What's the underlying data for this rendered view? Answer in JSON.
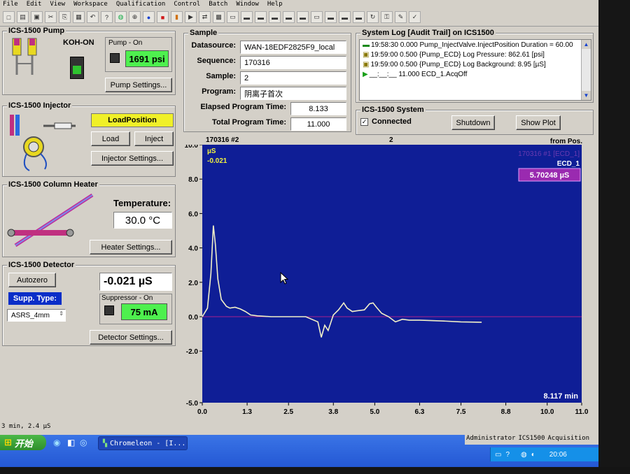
{
  "menu": [
    "File",
    "Edit",
    "View",
    "Workspace",
    "Qualification",
    "Control",
    "Batch",
    "Window",
    "Help"
  ],
  "pump": {
    "title": "ICS-1500 Pump",
    "eluent": "KOH-ON",
    "status_label": "Pump - On",
    "pressure": "1691 psi",
    "settings_btn": "Pump Settings..."
  },
  "injector": {
    "title": "ICS-1500 Injector",
    "position": "LoadPosition",
    "load_btn": "Load",
    "inject_btn": "Inject",
    "settings_btn": "Injector Settings..."
  },
  "heater": {
    "title": "ICS-1500 Column Heater",
    "temp_label": "Temperature:",
    "temp_value": "30.0 °C",
    "settings_btn": "Heater Settings..."
  },
  "detector": {
    "title": "ICS-1500 Detector",
    "autozero_btn": "Autozero",
    "supp_type_label": "Supp. Type:",
    "supp_type_value": "ASRS_4mm",
    "value": "-0.021 µS",
    "suppressor_label": "Suppressor - On",
    "suppressor_value": "75 mA",
    "settings_btn": "Detector Settings..."
  },
  "sample": {
    "title": "Sample",
    "rows": [
      {
        "label": "Datasource:",
        "value": "WAN-18EDF2825F9_local"
      },
      {
        "label": "Sequence:",
        "value": "170316"
      },
      {
        "label": "Sample:",
        "value": "2"
      },
      {
        "label": "Program:",
        "value": "阴离子首次"
      }
    ],
    "elapsed_label": "Elapsed Program Time:",
    "elapsed_value": "8.133",
    "total_label": "Total Program Time:",
    "total_value": "11.000"
  },
  "log": {
    "title": "System Log [Audit Trail] on ICS1500",
    "lines": [
      "19:58:30 0.000 Pump_InjectValve.InjectPosition  Duration = 60.00",
      "19:59:00 0.500 {Pump_ECD} Log Pressure: 862.61 [psi]",
      "19:59:00 0.500 {Pump_ECD} Log Background: 8.95 [µS]",
      "__:__:__ 11.000 ECD_1.AcqOff"
    ]
  },
  "system": {
    "title": "ICS-1500 System",
    "connected_label": "Connected",
    "shutdown_btn": "Shutdown",
    "showplot_btn": "Show Plot"
  },
  "plot": {
    "header_left": "170316 #2",
    "header_mid": "2",
    "header_right": "from Pos.",
    "unit": "µS",
    "current": "-0.021",
    "trace_label": "170316 #1 [ECD_1]",
    "channel": "ECD_1",
    "live_value": "5.70248 µS",
    "time_readout": "8.117 min",
    "accent": "#0f1e96"
  },
  "chart_data": {
    "type": "line",
    "xlim": [
      0.0,
      11.0
    ],
    "ylim": [
      -5.0,
      10.0
    ],
    "xticks": [
      "0.0",
      "1.3",
      "2.5",
      "3.8",
      "5.0",
      "6.3",
      "7.5",
      "8.8",
      "10.0",
      "11.0"
    ],
    "yticks": [
      "10.0",
      "8.0",
      "6.0",
      "4.0",
      "2.0",
      "0.0",
      "-2.0",
      "-5.0"
    ],
    "series": [
      {
        "x": [
          0.0,
          0.15,
          0.25,
          0.32,
          0.38,
          0.45,
          0.55,
          0.7,
          0.8,
          0.95,
          1.1,
          1.25,
          1.4,
          1.6,
          2.0,
          2.5,
          3.0,
          3.35,
          3.45,
          3.55,
          3.65,
          3.8,
          3.95,
          4.1,
          4.2,
          4.35,
          4.5,
          4.7,
          4.85,
          4.95,
          5.05,
          5.2,
          5.4,
          5.6,
          5.8,
          6.0,
          6.3,
          7.0,
          7.5,
          8.1
        ],
        "values": [
          0.0,
          0.5,
          2.5,
          5.3,
          4.2,
          2.2,
          1.0,
          0.6,
          0.5,
          0.55,
          0.45,
          0.3,
          0.1,
          0.05,
          0.0,
          0.0,
          0.0,
          -0.3,
          -1.2,
          -0.5,
          -0.8,
          0.1,
          0.4,
          0.8,
          0.5,
          0.3,
          0.35,
          0.4,
          0.75,
          0.8,
          0.55,
          0.2,
          0.0,
          -0.3,
          -0.15,
          -0.2,
          -0.2,
          -0.25,
          -0.3,
          -0.32
        ]
      }
    ]
  },
  "status": {
    "coords": "3 min, 2.4 µS"
  },
  "taskbar": {
    "start": "开始",
    "window": "Chromeleon - [I...",
    "user": "Administrator",
    "instrument": "ICS1500",
    "mode": "Acquisition",
    "clock": "20:06"
  }
}
